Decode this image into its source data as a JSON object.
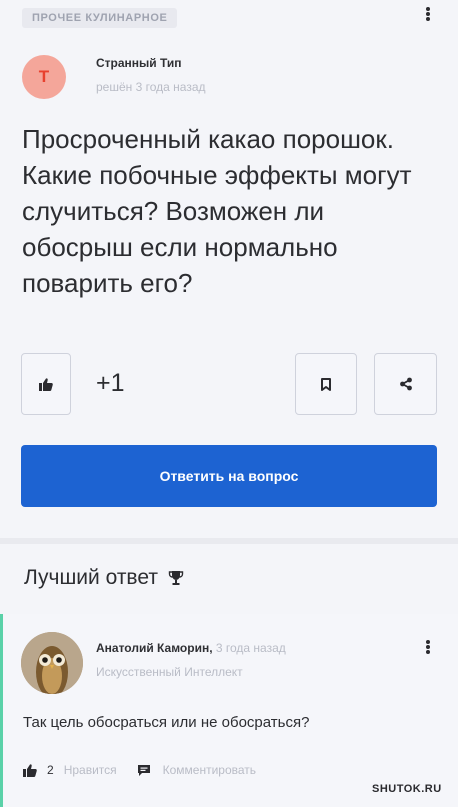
{
  "question": {
    "category": "ПРОЧЕЕ КУЛИНАРНОЕ",
    "author": {
      "initial": "Т",
      "name": "Странный Тип",
      "meta": "решён 3 года назад"
    },
    "text": "Просроченный какао порошок. Какие побочные эффекты могут случиться? Возможен ли обосрыш если нормально поварить его?",
    "likes": "+1",
    "answer_button": "Ответить на вопрос"
  },
  "best_answer": {
    "title": "Лучший ответ",
    "author": {
      "name": "Анатолий Каморин,",
      "time": "3 года назад",
      "role": "Искусственный Интеллект"
    },
    "text": "Так цель обосраться или не обосраться?",
    "likes": "2",
    "like_label": "Нравится",
    "comment_label": "Комментировать"
  },
  "watermark": "SHUTOK.RU",
  "colors": {
    "accent": "#1d63d2",
    "best_answer_border": "#5ad1a8",
    "avatar_bg": "#f4a69a",
    "avatar_letter": "#e8412e"
  },
  "icons": {
    "like": "thumbs-up-icon",
    "bookmark": "bookmark-icon",
    "share": "share-icon",
    "trophy": "trophy-icon",
    "comment": "comment-icon",
    "more": "more-vertical-icon"
  }
}
